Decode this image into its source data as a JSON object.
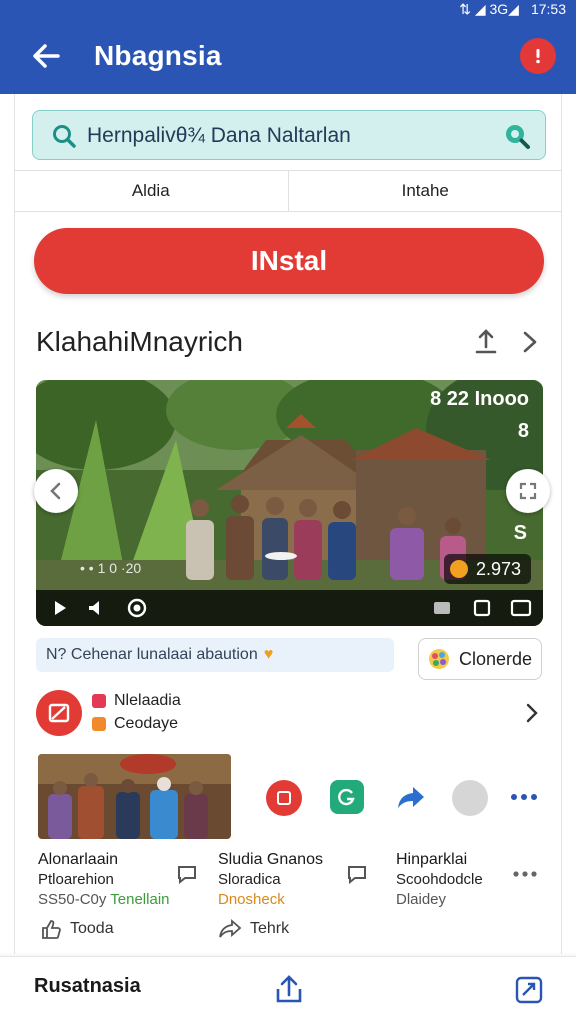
{
  "status_bar": {
    "icons": "⇅  ◢ 3G◢",
    "time": "17:53"
  },
  "app_bar": {
    "title": "Nbagnsia",
    "back_icon": "arrow-left-icon",
    "menu_icon": "alert-icon"
  },
  "search": {
    "value": "Hernpalivθ¾ Dana Naltarlan"
  },
  "tabs": [
    "Aldia",
    "Intahe"
  ],
  "install_label": "INstal",
  "section": {
    "title": "KlahahiMnayrich"
  },
  "media": {
    "overlay_title": "8 22 Inooo",
    "overlay_b": "8",
    "overlay_s": "S",
    "count": "2.973",
    "caption": "• • 1 0 ·20"
  },
  "chip": {
    "text": "N? Cehenar lunalaai abaution"
  },
  "pill_button": {
    "label": "Clonerde"
  },
  "source": {
    "line1": "Nlelaadia",
    "line2": "Ceodaye"
  },
  "items": [
    {
      "title": "Alonarlaain",
      "sub": "Ptloarehion",
      "meta_prefix": "SS50-C0y",
      "meta_accent": "Tenellain"
    },
    {
      "title": "Sludia Gnanos",
      "sub": "Sloradica",
      "meta_accent": "Dnosheck"
    },
    {
      "title": "Hinparklai",
      "sub": "Scoohdodcle",
      "meta_accent": "Dlaidey"
    }
  ],
  "footer_actions": [
    "Tooda",
    "Tehrk"
  ],
  "bottom_bar": {
    "title": "Rusatnasia"
  },
  "colors": {
    "primary": "#2a55b4",
    "install": "#e23a35",
    "search_bg": "#d3f0ef"
  }
}
